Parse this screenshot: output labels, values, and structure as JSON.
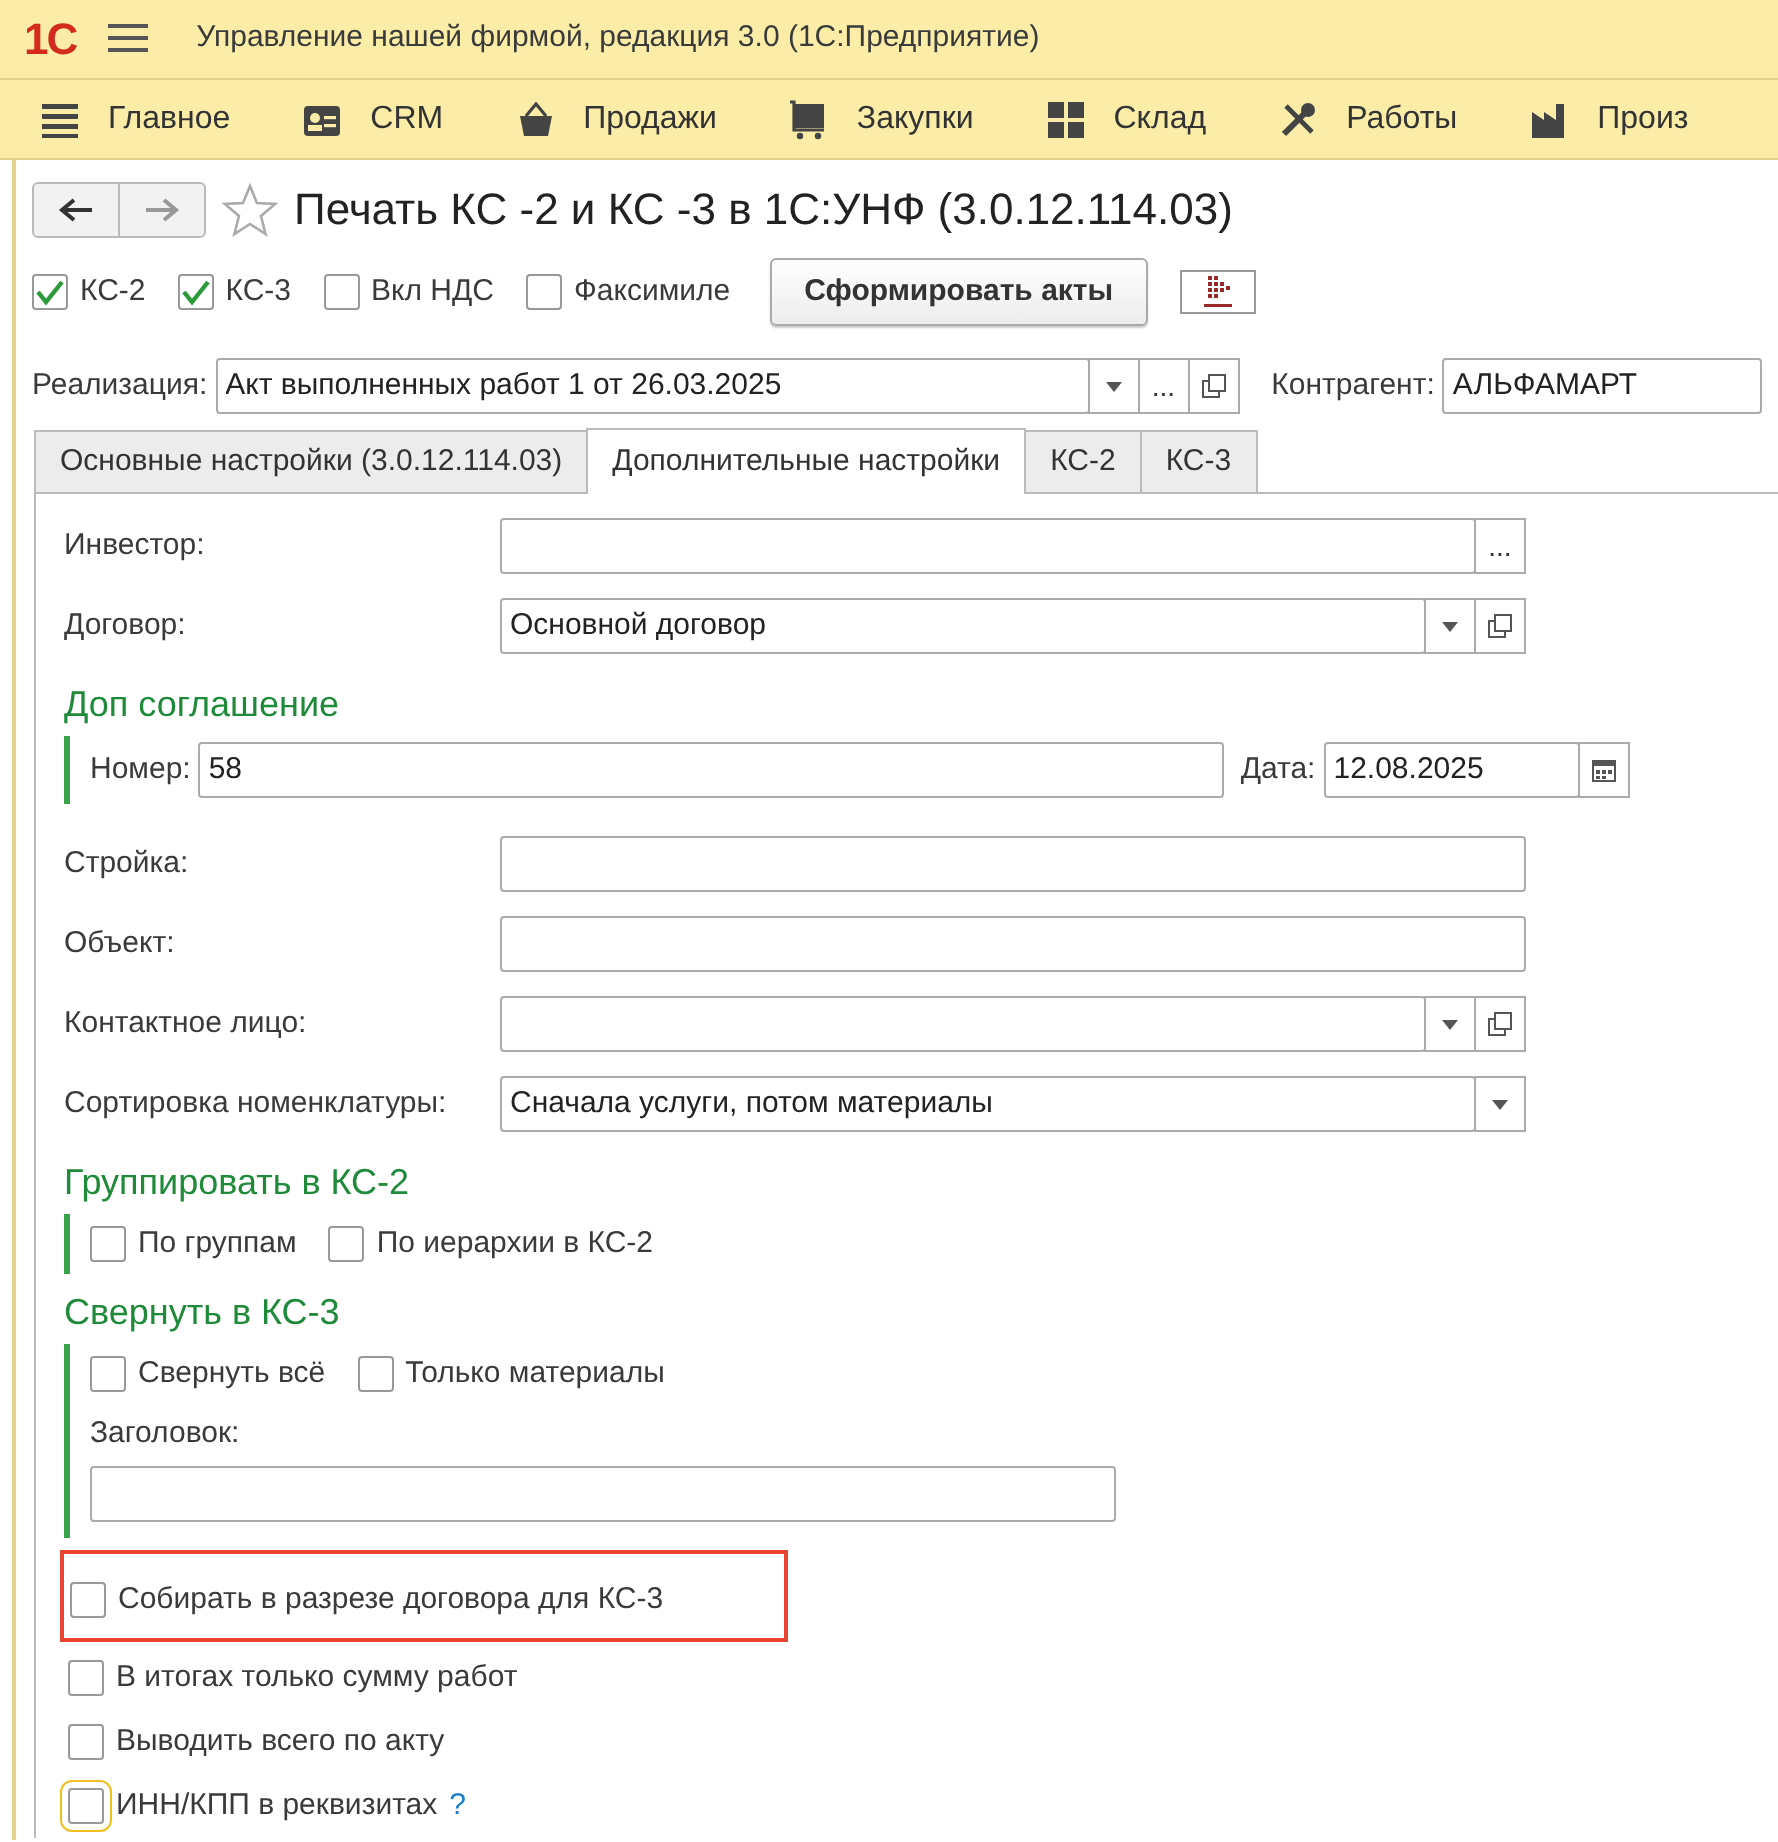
{
  "app": {
    "logo": "1С",
    "title": "Управление нашей фирмой, редакция 3.0  (1С:Предприятие)"
  },
  "sections": [
    {
      "label": "Главное"
    },
    {
      "label": "CRM"
    },
    {
      "label": "Продажи"
    },
    {
      "label": "Закупки"
    },
    {
      "label": "Склад"
    },
    {
      "label": "Работы"
    },
    {
      "label": "Произ"
    }
  ],
  "form": {
    "title": "Печать КС -2 и КС -3 в 1С:УНФ (3.0.12.114.03)",
    "favorite": false
  },
  "options": [
    {
      "label": "КС-2",
      "checked": true
    },
    {
      "label": "КС-3",
      "checked": true
    },
    {
      "label": "Вкл НДС",
      "checked": false
    },
    {
      "label": "Факсимиле",
      "checked": false
    }
  ],
  "generate_button": "Сформировать акты",
  "realization": {
    "label": "Реализация:",
    "value": "Акт выполненных работ 1 от 26.03.2025",
    "more": "..."
  },
  "counterparty": {
    "label": "Контрагент:",
    "value": "АЛЬФАМАРТ"
  },
  "tabs": [
    {
      "label": "Основные настройки (3.0.12.114.03)",
      "selected": false
    },
    {
      "label": "Дополнительные настройки",
      "selected": true
    },
    {
      "label": "КС-2",
      "selected": false
    },
    {
      "label": "КС-3",
      "selected": false
    }
  ],
  "rows": [
    {
      "kind": "field",
      "label": "Инвестор:",
      "value": "",
      "more": "..."
    },
    {
      "kind": "field",
      "label": "Договор:",
      "value": "Основной договор",
      "dropdown": true,
      "open": true
    },
    {
      "kind": "heading",
      "text": "Доп соглашение"
    },
    {
      "kind": "group",
      "rows": [
        {
          "kind": "pair",
          "label": "Номер:",
          "value": "58",
          "label2": "Дата:",
          "value2": "12.08.2025"
        }
      ]
    },
    {
      "kind": "field",
      "label": "Стройка:",
      "value": ""
    },
    {
      "kind": "field",
      "label": "Объект:",
      "value": ""
    },
    {
      "kind": "field",
      "label": "Контактное лицо:",
      "value": "",
      "dropdown": true,
      "open": true
    },
    {
      "kind": "field",
      "label": "Сортировка номенклатуры:",
      "value": "Сначала услуги, потом материалы",
      "dropdown": true
    },
    {
      "kind": "heading",
      "text": "Группировать в КС-2"
    },
    {
      "kind": "group",
      "rows": [
        {
          "kind": "checks",
          "items": [
            {
              "label": "По группам",
              "checked": false
            },
            {
              "label": "По иерархии в КС-2",
              "checked": false
            }
          ]
        }
      ]
    },
    {
      "kind": "heading",
      "text": "Свернуть в КС-3"
    },
    {
      "kind": "group",
      "rows": [
        {
          "kind": "checks",
          "items": [
            {
              "label": "Свернуть всё",
              "checked": false
            },
            {
              "label": "Только материалы",
              "checked": false
            }
          ]
        },
        {
          "kind": "stacked",
          "label": "Заголовок:",
          "value": ""
        }
      ]
    },
    {
      "kind": "check",
      "label": "Собирать в разрезе договора для КС-3",
      "checked": false,
      "highlighted": true
    },
    {
      "kind": "check",
      "label": "В итогах только сумму работ",
      "checked": false
    },
    {
      "kind": "check",
      "label": "Выводить всего по акту",
      "checked": false
    },
    {
      "kind": "check",
      "label": "ИНН/КПП в реквизитах",
      "checked": false,
      "focused": true,
      "help": "?"
    }
  ]
}
